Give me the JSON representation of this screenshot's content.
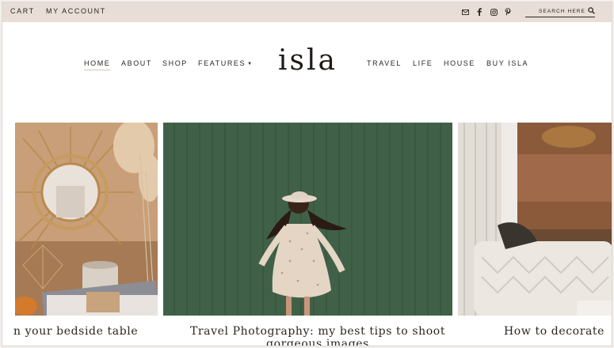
{
  "topbar": {
    "cart": "CART",
    "account": "MY ACCOUNT",
    "search_placeholder": "SEARCH HERE"
  },
  "social_icons": [
    "mail-icon",
    "facebook-icon",
    "instagram-icon",
    "pinterest-icon"
  ],
  "nav": {
    "left": [
      "HOME",
      "ABOUT",
      "SHOP",
      "FEATURES"
    ],
    "right": [
      "TRAVEL",
      "LIFE",
      "HOUSE",
      "BUY ISLA"
    ],
    "active": "HOME"
  },
  "logo": "isla",
  "slides": [
    {
      "caption": "n your bedside table"
    },
    {
      "caption": "Travel Photography: my best tips to shoot gorgeous images"
    },
    {
      "caption": "How to decorate"
    }
  ],
  "colors": {
    "topbar_bg": "#e8ded7",
    "text": "#2b2622",
    "green_door": "#3d5e44"
  }
}
